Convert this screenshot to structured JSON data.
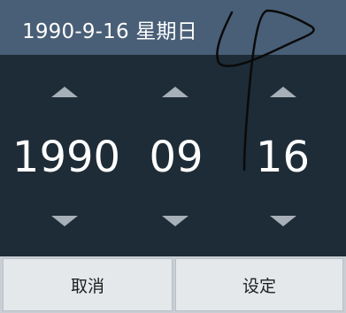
{
  "header": {
    "title": "1990-9-16 星期日"
  },
  "picker": {
    "year": "1990",
    "month": "09",
    "day": "16"
  },
  "buttons": {
    "cancel_label": "取消",
    "set_label": "设定"
  },
  "colors": {
    "header_bg": "#495f77",
    "picker_bg": "#1e2c37",
    "arrow": "#a7b0b8",
    "button_bg": "#e4e8eb"
  }
}
